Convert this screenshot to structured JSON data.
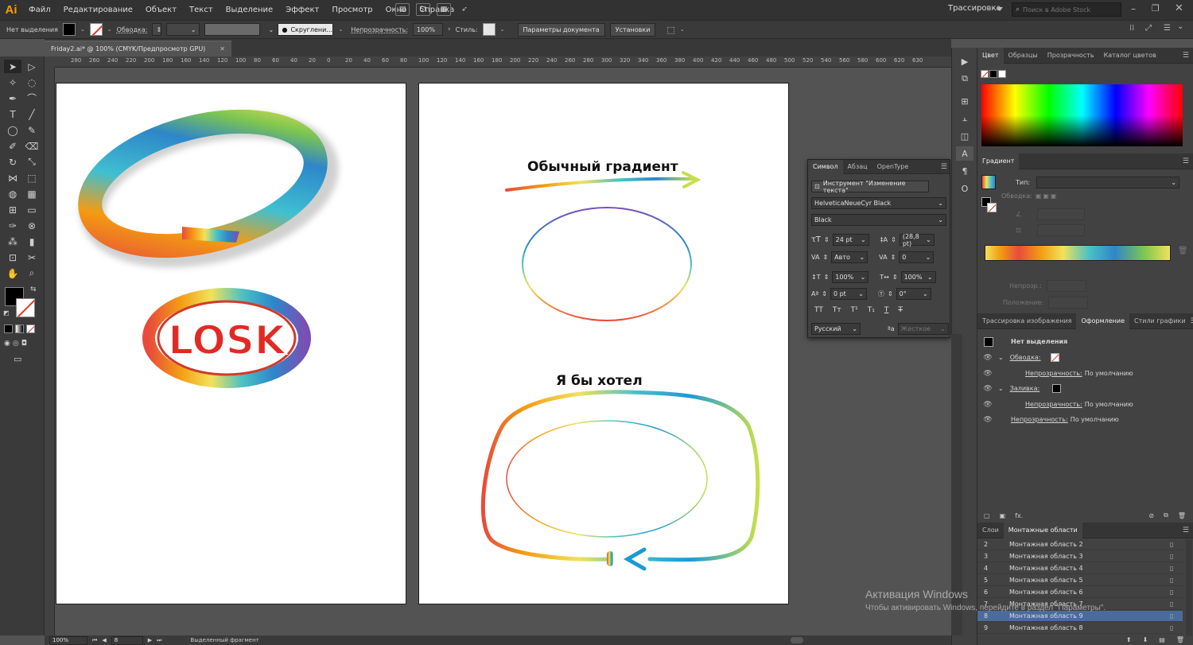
{
  "app": {
    "logo": "Ai",
    "menu": [
      "Файл",
      "Редактирование",
      "Объект",
      "Текст",
      "Выделение",
      "Эффект",
      "Просмотр",
      "Окно",
      "Справка"
    ],
    "workspace": "Трассировка",
    "search_placeholder": "Поиск в Adobe Stock"
  },
  "control_bar": {
    "selection": "Нет выделения",
    "stroke_label": "Обводка:",
    "brush": "Скруглени...",
    "opacity_label": "Непрозрачность:",
    "opacity_value": "100%",
    "style_label": "Стиль:",
    "doc_params": "Параметры документа",
    "settings": "Установки"
  },
  "document": {
    "tab_title": "Friday2.ai* @ 100% (CMYK/Предпросмотр GPU)",
    "ruler_ticks": [
      "280",
      "260",
      "240",
      "220",
      "200",
      "180",
      "160",
      "140",
      "120",
      "100",
      "80",
      "60",
      "40",
      "20",
      "0",
      "20",
      "40",
      "60",
      "80",
      "100",
      "120",
      "140",
      "160",
      "180",
      "200",
      "220",
      "240",
      "260",
      "280",
      "300",
      "320",
      "340",
      "360",
      "380",
      "400",
      "420",
      "440",
      "460",
      "480",
      "500",
      "520",
      "540",
      "560",
      "580",
      "600",
      "620",
      "630"
    ]
  },
  "artwork": {
    "logo_text": "LOSK",
    "heading_1": "Обычный градиент",
    "heading_2": "Я бы хотел"
  },
  "colors": {
    "accent_orange": "#ff9a00",
    "panel_bg": "#424242",
    "menubar_bg": "#323232",
    "selection_blue": "#4a6b9c",
    "rainbow": [
      "#e84b3c",
      "#f39c12",
      "#f1e25a",
      "#4bc2c5",
      "#2e86c9",
      "#7a4fb5"
    ]
  },
  "character_panel": {
    "tabs": [
      "Символ",
      "Абзац",
      "OpenType"
    ],
    "touch_tool": "Инструмент \"Изменение текста\"",
    "font_family": "HelveticaNeueCyr Black",
    "font_style": "Black",
    "size": "24 pt",
    "leading": "(28,8 pt)",
    "kerning": "Авто",
    "tracking": "0",
    "vscale": "100%",
    "hscale": "100%",
    "baseline": "0 pt",
    "rotation": "0°",
    "language": "Русский",
    "aa": "Жесткое"
  },
  "color_panel": {
    "tabs": [
      "Цвет",
      "Образцы",
      "Прозрачность",
      "Каталог цветов"
    ]
  },
  "gradient_panel": {
    "title": "Градиент",
    "type_label": "Тип:",
    "stroke_label": "Обводка:",
    "opacity_label": "Непрозр.:",
    "location_label": "Положение:"
  },
  "appearance_panel": {
    "tabs": [
      "Трассировка изображения",
      "Оформление",
      "Стили графики"
    ],
    "title": "Нет выделения",
    "stroke": "Обводка:",
    "opacity_1": "Непрозрачность:",
    "default_1": "По умолчанию",
    "fill": "Заливка:",
    "opacity_2": "Непрозрачность:",
    "default_2": "По умолчанию",
    "opacity_3": "Непрозрачность:",
    "default_3": "По умолчанию"
  },
  "artboards_panel": {
    "tabs": [
      "Слои",
      "Монтажные области"
    ],
    "rows": [
      {
        "num": "2",
        "name": "Монтажная область 2"
      },
      {
        "num": "3",
        "name": "Монтажная область 3"
      },
      {
        "num": "4",
        "name": "Монтажная область 4"
      },
      {
        "num": "5",
        "name": "Монтажная область 5"
      },
      {
        "num": "6",
        "name": "Монтажная область 6"
      },
      {
        "num": "7",
        "name": "Монтажная область 7"
      },
      {
        "num": "8",
        "name": "Монтажная область 9"
      },
      {
        "num": "9",
        "name": "Монтажная область 8"
      }
    ],
    "selected_index": 6
  },
  "status_bar": {
    "zoom": "100%",
    "artboard": "8",
    "status": "Выделенный фрагмент"
  },
  "watermark": {
    "title": "Активация Windows",
    "subtitle": "Чтобы активировать Windows, перейдите в раздел \"Параметры\"."
  }
}
